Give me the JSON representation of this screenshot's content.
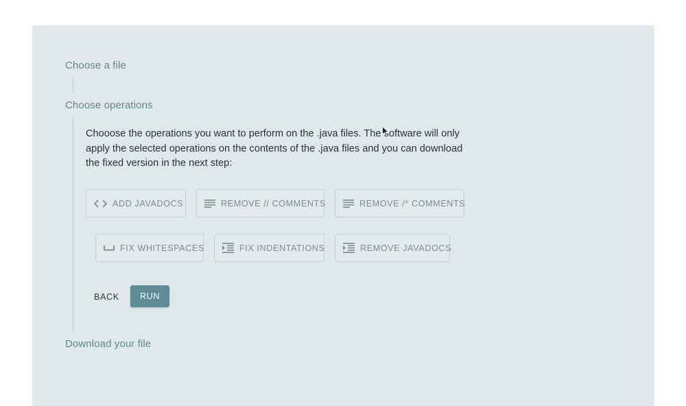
{
  "steps": {
    "step1": {
      "title": "Choose a file"
    },
    "step2": {
      "title": "Choose operations",
      "description": "Chooose the operations you want to perform on the .java files. The software will only apply the selected operations on the contents of the .java files and you can download the fixed version in the next step:",
      "operations": [
        {
          "label": "ADD JAVADOCS",
          "icon": "code-icon"
        },
        {
          "label": "REMOVE // COMMENTS",
          "icon": "notes-icon"
        },
        {
          "label": "REMOVE /* COMMENTS",
          "icon": "notes-icon"
        },
        {
          "label": "FIX WHITESPACES",
          "icon": "space-bar-icon"
        },
        {
          "label": "FIX INDENTATIONS",
          "icon": "format-indent-increase-icon"
        },
        {
          "label": "REMOVE JAVADOCS",
          "icon": "format-indent-increase-icon"
        }
      ],
      "back_label": "BACK",
      "run_label": "RUN"
    },
    "step3": {
      "title": "Download your file"
    }
  },
  "colors": {
    "background": "#ffffff",
    "panel": "#e1e8ec",
    "step_title": "#5f8791",
    "primary": "#5e8b95",
    "button_text": "#7f8b91"
  }
}
